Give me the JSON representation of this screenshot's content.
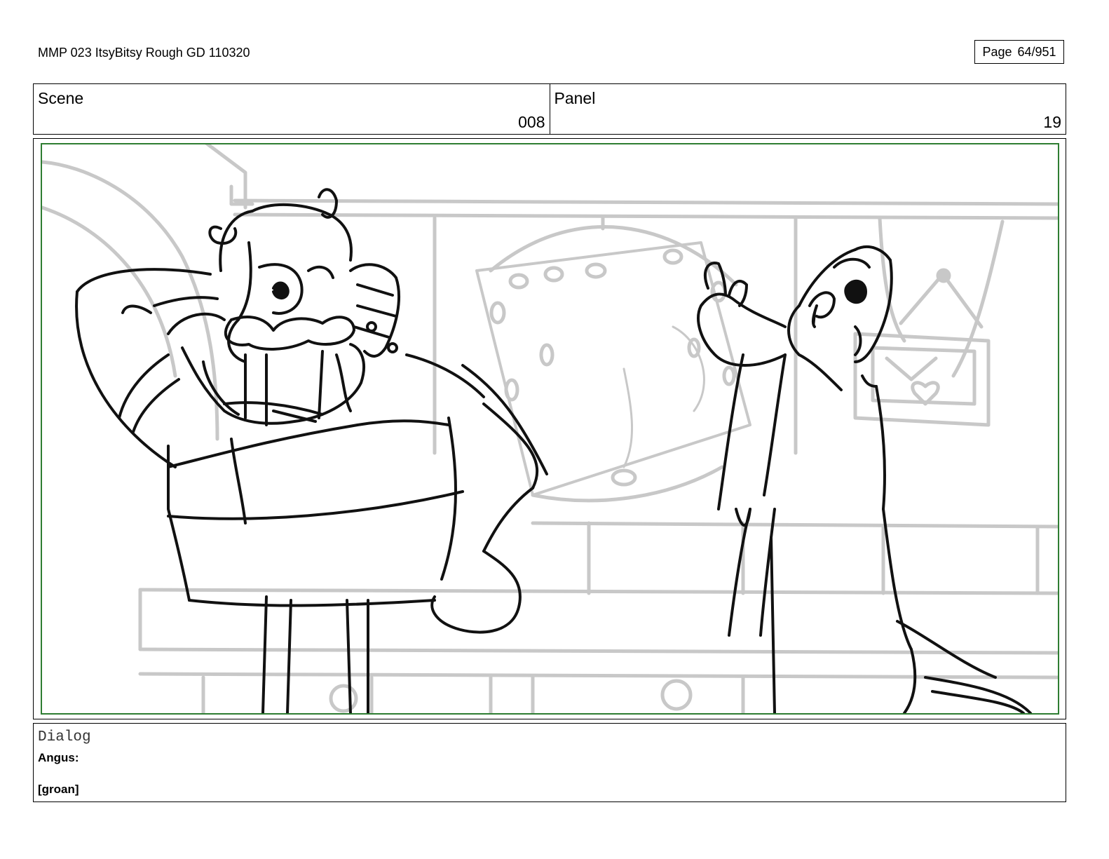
{
  "header": {
    "document_title": "MMP 023 ItsyBitsy Rough GD 110320",
    "page_label": "Page",
    "page_number": "64/951"
  },
  "scene": {
    "label": "Scene",
    "value": "008"
  },
  "panel": {
    "label": "Panel",
    "value": "19"
  },
  "dialog": {
    "label": "Dialog",
    "speaker": "Angus:",
    "line": "[groan]"
  },
  "colors": {
    "panel_border": "#2e7d32",
    "background_sketch": "#c8c8c8",
    "character_lines": "#000000"
  }
}
